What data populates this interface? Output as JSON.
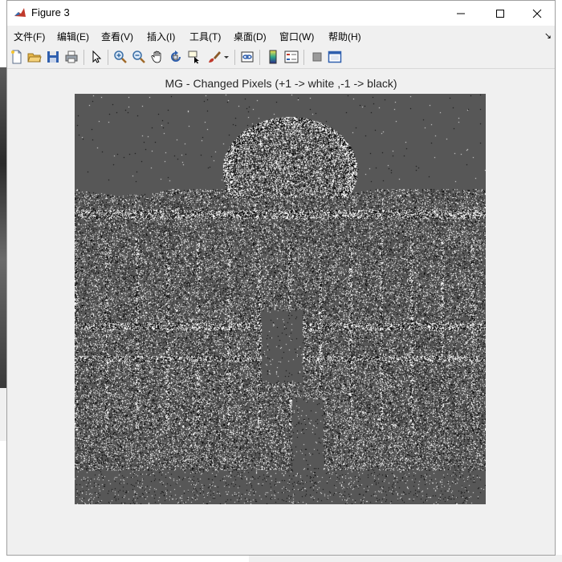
{
  "window": {
    "title": "Figure 3",
    "controls": {
      "minimize": "minimize",
      "maximize": "maximize",
      "close": "close"
    }
  },
  "menu": {
    "items": [
      "文件(F)",
      "编辑(E)",
      "查看(V)",
      "插入(I)",
      "工具(T)",
      "桌面(D)",
      "窗口(W)",
      "帮助(H)"
    ],
    "overflow": "↘"
  },
  "toolbar": {
    "buttons": [
      "new-figure-icon",
      "open-file-icon",
      "save-icon",
      "print-icon",
      "pointer-icon",
      "zoom-in-icon",
      "zoom-out-icon",
      "pan-hand-icon",
      "rotate-3d-icon",
      "data-cursor-icon",
      "brush-icon",
      "link-plot-icon",
      "colorbar-icon",
      "legend-icon",
      "hide-plot-tools-icon",
      "show-plot-tools-icon"
    ]
  },
  "figure": {
    "title": "MG - Changed Pixels (+1 -> white ,-1 -> black)",
    "background": "#575757",
    "positive_color": "#ffffff",
    "negative_color": "#000000"
  }
}
